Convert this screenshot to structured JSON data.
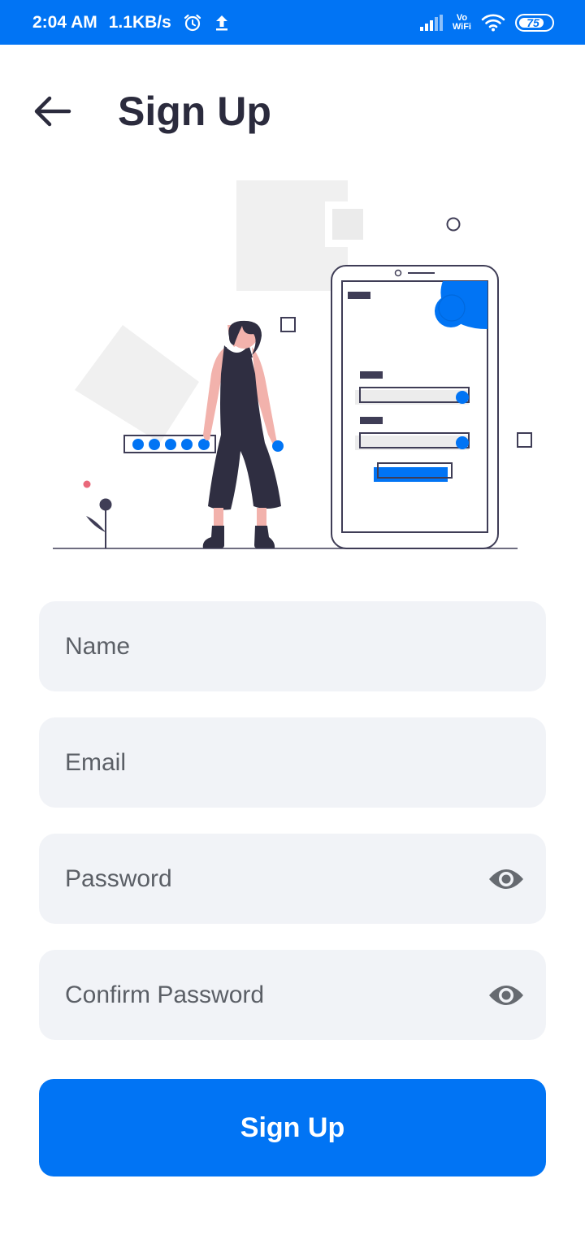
{
  "status_bar": {
    "time": "2:04 AM",
    "network_speed": "1.1KB/s",
    "alarm_icon": "alarm-icon",
    "upload_icon": "upload-icon",
    "signal_icon": "signal-icon",
    "vowifi_top": "Vo",
    "vowifi_bottom": "WiFi",
    "wifi_icon": "wifi-icon",
    "battery_level": "75"
  },
  "header": {
    "back_icon": "arrow-left-icon",
    "title": "Sign Up"
  },
  "form": {
    "name_placeholder": "Name",
    "email_placeholder": "Email",
    "password_placeholder": "Password",
    "confirm_password_placeholder": "Confirm Password",
    "eye_icon": "eye-icon"
  },
  "submit": {
    "label": "Sign Up"
  },
  "colors": {
    "accent": "#0174f4",
    "text_dark": "#2b2b3d",
    "field_bg": "#f1f3f7",
    "placeholder": "#5b5f66"
  }
}
